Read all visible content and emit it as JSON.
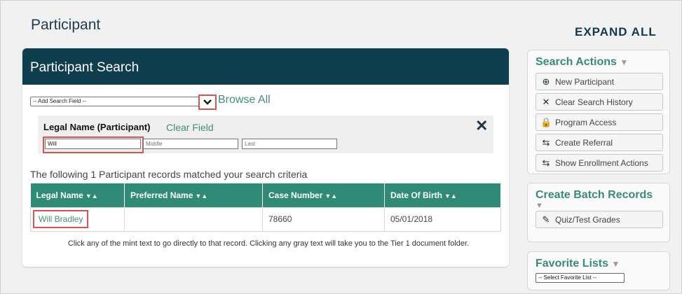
{
  "page": {
    "title": "Participant",
    "expand_all": "EXPAND ALL"
  },
  "search_panel": {
    "title": "Participant Search",
    "add_field_placeholder": "-- Add Search Field --",
    "browse_all": "Browse All",
    "field_label": "Legal Name (Participant)",
    "clear_field": "Clear Field",
    "first_value": "Will",
    "middle_placeholder": "Middle",
    "last_placeholder": "Last"
  },
  "results": {
    "summary": "The following 1 Participant records matched your search criteria",
    "columns": [
      "Legal Name",
      "Preferred Name",
      "Case Number",
      "Date Of Birth"
    ],
    "rows": [
      {
        "legal_name": "Will Bradley",
        "preferred_name": "",
        "case_number": "78660",
        "dob": "05/01/2018"
      }
    ],
    "footnote": "Click any of the mint text to go directly to that record. Clicking any gray text will take you to the Tier 1 document folder."
  },
  "search_actions": {
    "title": "Search Actions",
    "items": [
      {
        "label": "New Participant",
        "icon": "plus-circle-icon"
      },
      {
        "label": "Clear Search History",
        "icon": "close-icon"
      },
      {
        "label": "Program Access",
        "icon": "lock-icon"
      },
      {
        "label": "Create Referral",
        "icon": "swap-icon"
      },
      {
        "label": "Show Enrollment Actions",
        "icon": "swap-icon"
      }
    ]
  },
  "batch_records": {
    "title": "Create Batch Records",
    "items": [
      {
        "label": "Quiz/Test Grades",
        "icon": "pencil-icon"
      }
    ]
  },
  "favorite_lists": {
    "title": "Favorite Lists",
    "select_placeholder": "-- Select Favorite List --"
  },
  "colors": {
    "header_bg": "#0f3e4e",
    "mint": "#3f8e7a",
    "table_header": "#2f8b76",
    "highlight": "#d9534f"
  }
}
